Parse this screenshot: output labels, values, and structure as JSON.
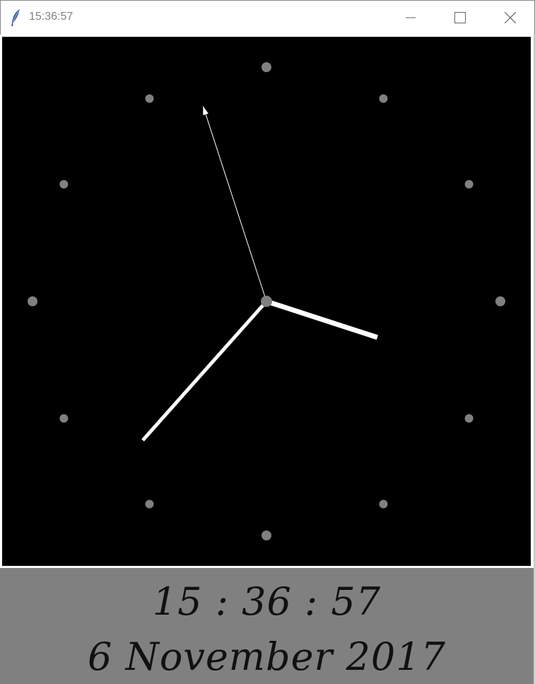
{
  "window": {
    "title": "15:36:57",
    "icon": "feather-icon",
    "controls": [
      "minimize-icon",
      "maximize-icon",
      "close-icon"
    ]
  },
  "clock": {
    "time": {
      "hours": 15,
      "minutes": 36,
      "seconds": 57
    },
    "face_color": "#000000",
    "marker_color": "#808080",
    "hand_color": "#ffffff"
  },
  "display": {
    "time_text": "15 : 36 : 57",
    "date_text": "6 November 2017",
    "panel_color": "#808080"
  }
}
